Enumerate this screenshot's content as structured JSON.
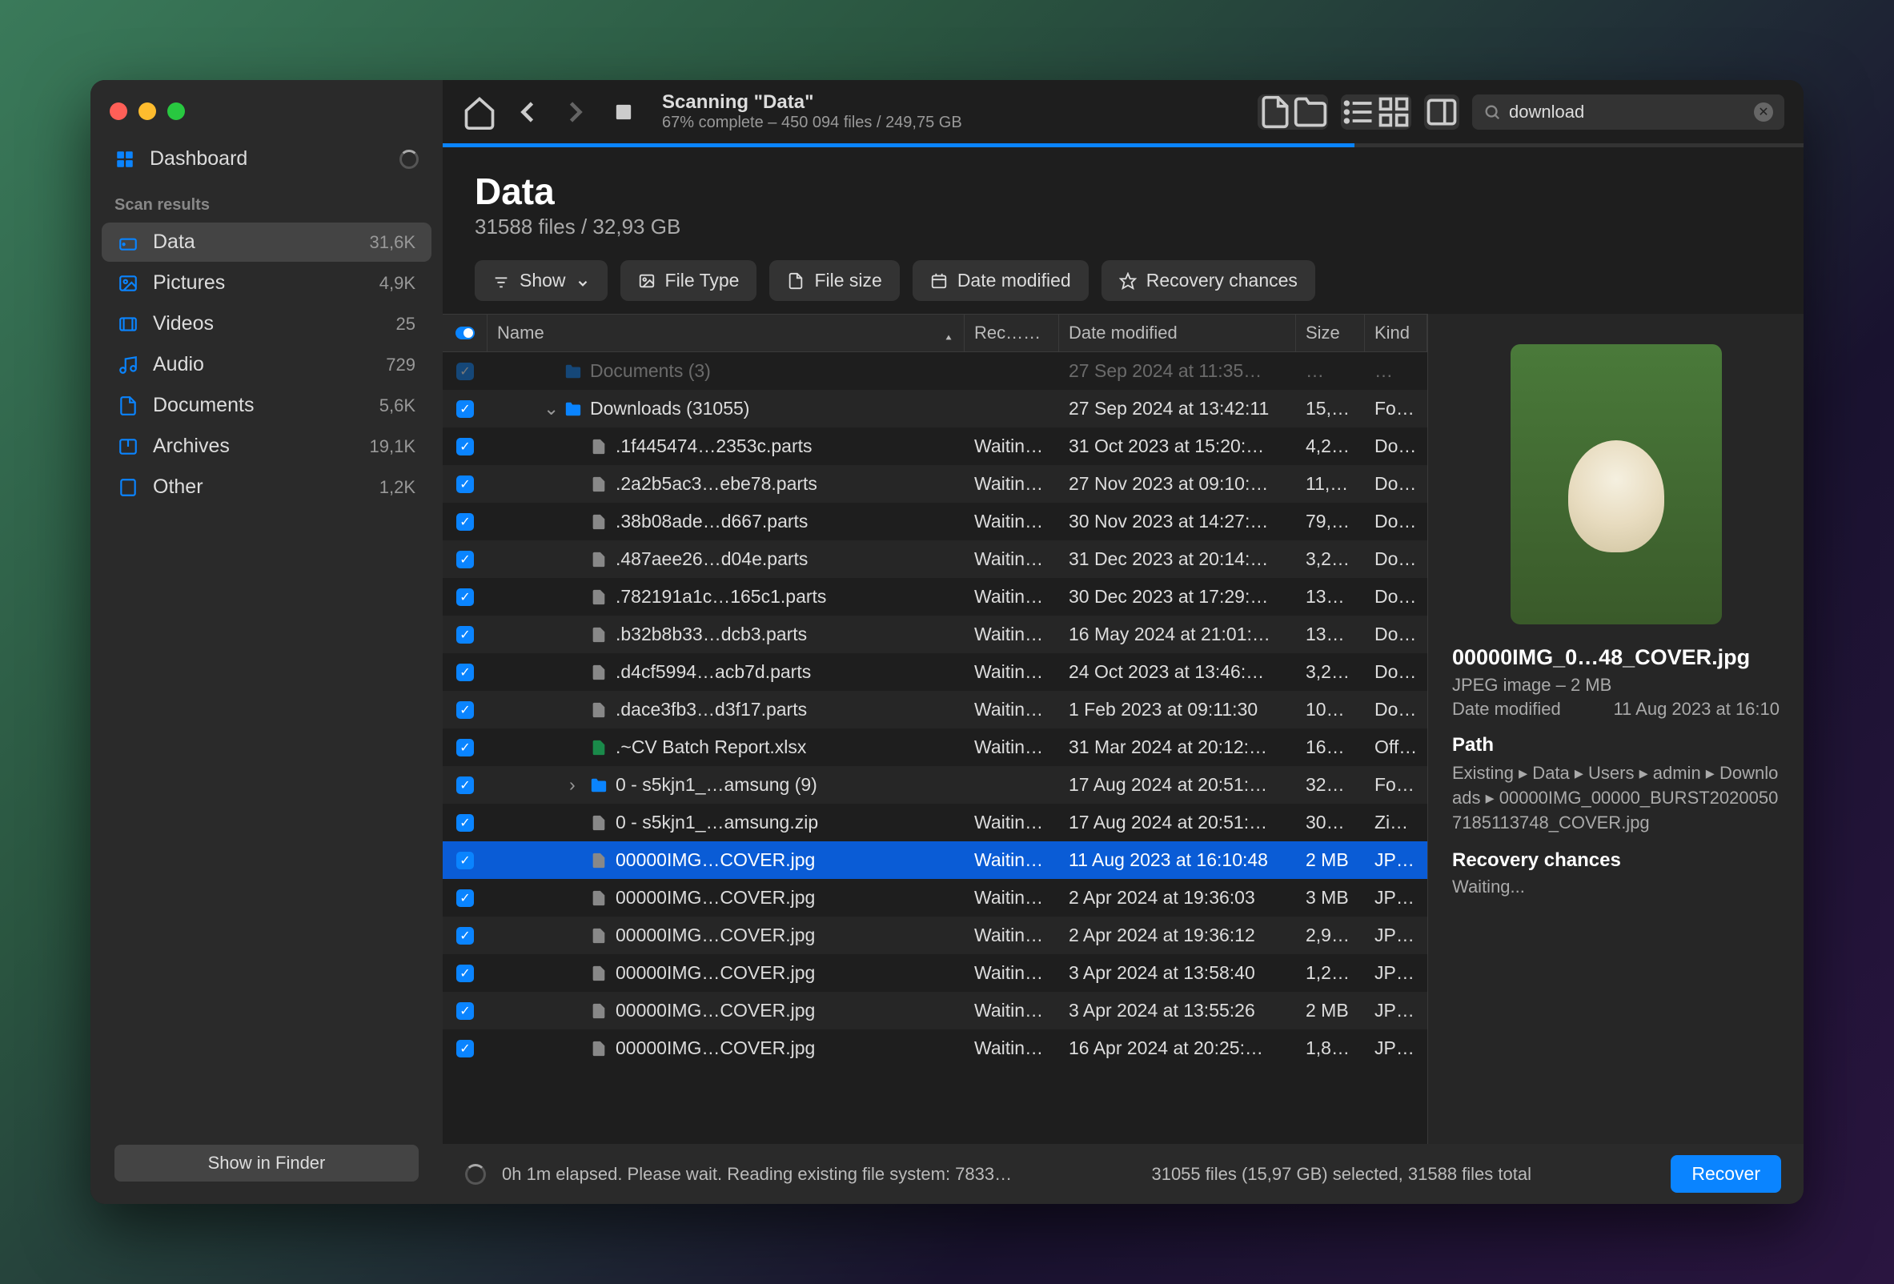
{
  "sidebar": {
    "dashboard": "Dashboard",
    "scan_results_label": "Scan results",
    "items": [
      {
        "icon": "disk",
        "label": "Data",
        "count": "31,6K",
        "active": true
      },
      {
        "icon": "picture",
        "label": "Pictures",
        "count": "4,9K"
      },
      {
        "icon": "video",
        "label": "Videos",
        "count": "25"
      },
      {
        "icon": "audio",
        "label": "Audio",
        "count": "729"
      },
      {
        "icon": "document",
        "label": "Documents",
        "count": "5,6K"
      },
      {
        "icon": "archive",
        "label": "Archives",
        "count": "19,1K"
      },
      {
        "icon": "other",
        "label": "Other",
        "count": "1,2K"
      }
    ],
    "finder_button": "Show in Finder"
  },
  "toolbar": {
    "title": "Scanning \"Data\"",
    "subtitle": "67% complete – 450 094 files / 249,75 GB",
    "progress": 67,
    "search_value": "download"
  },
  "header": {
    "title": "Data",
    "subtitle": "31588 files / 32,93 GB"
  },
  "filters": {
    "show": "Show",
    "file_type": "File Type",
    "file_size": "File size",
    "date_modified": "Date modified",
    "recovery": "Recovery chances"
  },
  "columns": {
    "name": "Name",
    "recovery": "Rec…nces",
    "date": "Date modified",
    "size": "Size",
    "kind": "Kind"
  },
  "rows": [
    {
      "indent": 0,
      "disc": "",
      "icon": "folder",
      "name": "Documents (3)",
      "rec": "",
      "date": "27 Sep 2024 at 11:35…",
      "size": "…",
      "kind": "…",
      "faded": true
    },
    {
      "indent": 0,
      "disc": "v",
      "icon": "folder",
      "name": "Downloads (31055)",
      "rec": "",
      "date": "27 Sep 2024 at 13:42:11",
      "size": "15,…",
      "kind": "Fol…"
    },
    {
      "indent": 1,
      "disc": "",
      "icon": "file",
      "name": ".1f445474…2353c.parts",
      "rec": "Waiting...",
      "date": "31 Oct 2023 at 15:20:…",
      "size": "4,2…",
      "kind": "Do…"
    },
    {
      "indent": 1,
      "disc": "",
      "icon": "file",
      "name": ".2a2b5ac3…ebe78.parts",
      "rec": "Waiting...",
      "date": "27 Nov 2023 at 09:10:…",
      "size": "11,…",
      "kind": "Do…"
    },
    {
      "indent": 1,
      "disc": "",
      "icon": "file",
      "name": ".38b08ade…d667.parts",
      "rec": "Waiting...",
      "date": "30 Nov 2023 at 14:27:…",
      "size": "79,…",
      "kind": "Do…"
    },
    {
      "indent": 1,
      "disc": "",
      "icon": "file",
      "name": ".487aee26…d04e.parts",
      "rec": "Waiting...",
      "date": "31 Dec 2023 at 20:14:…",
      "size": "3,2…",
      "kind": "Do…"
    },
    {
      "indent": 1,
      "disc": "",
      "icon": "file",
      "name": ".782191a1c…165c1.parts",
      "rec": "Waiting...",
      "date": "30 Dec 2023 at 17:29:…",
      "size": "13…",
      "kind": "Do…"
    },
    {
      "indent": 1,
      "disc": "",
      "icon": "file",
      "name": ".b32b8b33…dcb3.parts",
      "rec": "Waiting...",
      "date": "16 May 2024 at 21:01:…",
      "size": "13…",
      "kind": "Do…"
    },
    {
      "indent": 1,
      "disc": "",
      "icon": "file",
      "name": ".d4cf5994…acb7d.parts",
      "rec": "Waiting...",
      "date": "24 Oct 2023 at 13:46:…",
      "size": "3,2…",
      "kind": "Do…"
    },
    {
      "indent": 1,
      "disc": "",
      "icon": "file",
      "name": ".dace3fb3…d3f17.parts",
      "rec": "Waiting...",
      "date": "1 Feb 2023 at 09:11:30",
      "size": "10…",
      "kind": "Do…"
    },
    {
      "indent": 1,
      "disc": "",
      "icon": "xlsx",
      "name": ".~CV Batch Report.xlsx",
      "rec": "Waiting...",
      "date": "31 Mar 2024 at 20:12:…",
      "size": "16…",
      "kind": "Off…"
    },
    {
      "indent": 1,
      "disc": ">",
      "icon": "folder",
      "name": "0 - s5kjn1_…amsung (9)",
      "rec": "",
      "date": "17 Aug 2024 at 20:51:…",
      "size": "32…",
      "kind": "Fol…"
    },
    {
      "indent": 1,
      "disc": "",
      "icon": "file",
      "name": "0 - s5kjn1_…amsung.zip",
      "rec": "Waiting...",
      "date": "17 Aug 2024 at 20:51:…",
      "size": "30…",
      "kind": "Zip…"
    },
    {
      "indent": 1,
      "disc": "",
      "icon": "file",
      "name": "00000IMG…COVER.jpg",
      "rec": "Waiting...",
      "date": "11 Aug 2023 at 16:10:48",
      "size": "2 MB",
      "kind": "JP…",
      "selected": true
    },
    {
      "indent": 1,
      "disc": "",
      "icon": "file",
      "name": "00000IMG…COVER.jpg",
      "rec": "Waiting...",
      "date": "2 Apr 2024 at 19:36:03",
      "size": "3 MB",
      "kind": "JP…"
    },
    {
      "indent": 1,
      "disc": "",
      "icon": "file",
      "name": "00000IMG…COVER.jpg",
      "rec": "Waiting...",
      "date": "2 Apr 2024 at 19:36:12",
      "size": "2,9…",
      "kind": "JP…"
    },
    {
      "indent": 1,
      "disc": "",
      "icon": "file",
      "name": "00000IMG…COVER.jpg",
      "rec": "Waiting...",
      "date": "3 Apr 2024 at 13:58:40",
      "size": "1,2…",
      "kind": "JP…"
    },
    {
      "indent": 1,
      "disc": "",
      "icon": "file",
      "name": "00000IMG…COVER.jpg",
      "rec": "Waiting...",
      "date": "3 Apr 2024 at 13:55:26",
      "size": "2 MB",
      "kind": "JP…"
    },
    {
      "indent": 1,
      "disc": "",
      "icon": "file",
      "name": "00000IMG…COVER.jpg",
      "rec": "Waiting...",
      "date": "16 Apr 2024 at 20:25:…",
      "size": "1,8…",
      "kind": "JP…"
    }
  ],
  "preview": {
    "filename": "00000IMG_0…48_COVER.jpg",
    "type_line": "JPEG image – 2 MB",
    "date_label": "Date modified",
    "date_value": "11 Aug 2023 at 16:10",
    "path_label": "Path",
    "path_value": "Existing ▸ Data ▸ Users ▸ admin ▸ Downloads ▸ 00000IMG_00000_BURST20200507185113748_COVER.jpg",
    "recovery_label": "Recovery chances",
    "recovery_value": "Waiting..."
  },
  "footer": {
    "status": "0h 1m elapsed. Please wait. Reading existing file system: 7833…",
    "selection": "31055 files (15,97 GB) selected, 31588 files total",
    "recover": "Recover"
  }
}
